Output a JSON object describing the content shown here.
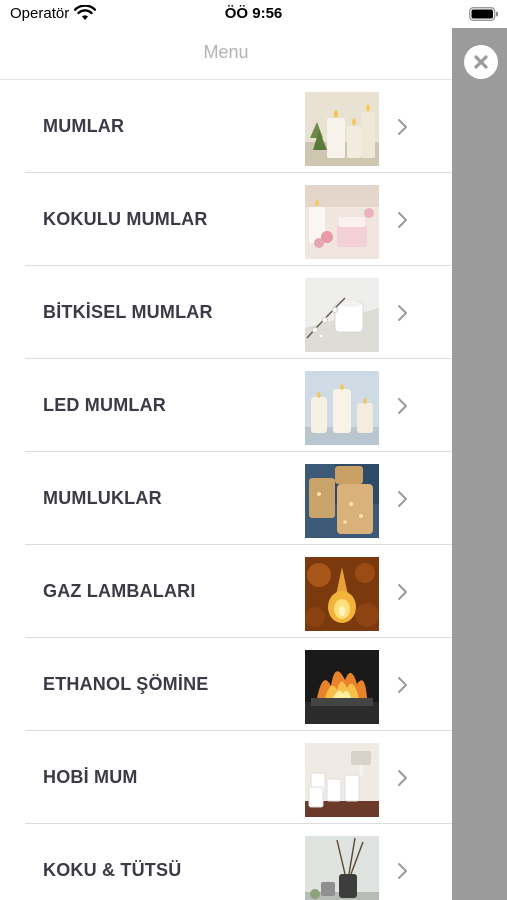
{
  "status_bar": {
    "carrier": "Operatör",
    "time": "ÖÖ 9:56"
  },
  "menu": {
    "title": "Menu",
    "items": [
      {
        "label": "MUMLAR",
        "thumb": "candles"
      },
      {
        "label": "KOKULU MUMLAR",
        "thumb": "scented-candles"
      },
      {
        "label": "BİTKİSEL MUMLAR",
        "thumb": "herbal-candles"
      },
      {
        "label": "LED MUMLAR",
        "thumb": "led-candles"
      },
      {
        "label": "MUMLUKLAR",
        "thumb": "candle-holders"
      },
      {
        "label": "GAZ LAMBALARI",
        "thumb": "gas-lamps"
      },
      {
        "label": "ETHANOL ŞÖMİNE",
        "thumb": "ethanol-fireplace"
      },
      {
        "label": "HOBİ MUM",
        "thumb": "hobby-candle"
      },
      {
        "label": "KOKU & TÜTSÜ",
        "thumb": "scent-incense"
      }
    ]
  },
  "icons": {
    "close": "close-icon",
    "chevron": "chevron-right-icon",
    "wifi": "wifi-icon",
    "battery": "battery-icon"
  },
  "colors": {
    "overlay": "#9b9b9b",
    "label": "#3b3b45",
    "title": "#b3b3b3",
    "divider": "#dcdcdc"
  }
}
